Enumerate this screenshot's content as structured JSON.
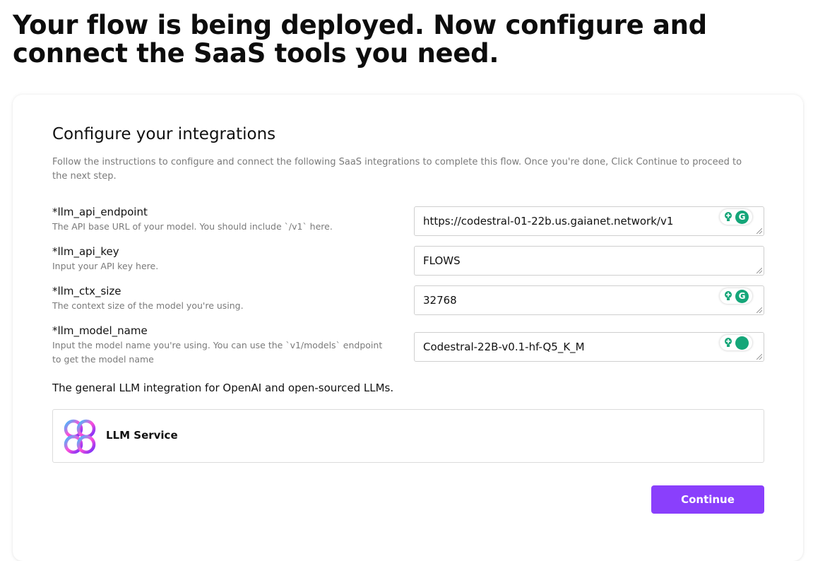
{
  "page": {
    "heading": "Your flow is being deployed. Now configure and connect the SaaS tools you need."
  },
  "card": {
    "title": "Configure your integrations",
    "description": "Follow the instructions to configure and connect the following SaaS integrations to complete this flow. Once you're done, Click Continue to proceed to the next step."
  },
  "fields": [
    {
      "label": "*llm_api_endpoint",
      "help": "The API base URL of your model. You should include `/v1` here.",
      "value": "https://codestral-01-22b.us.gaianet.network/v1",
      "extension_badge": "grammarly-icon"
    },
    {
      "label": "*llm_api_key",
      "help": "Input your API key here.",
      "value": "FLOWS"
    },
    {
      "label": "*llm_ctx_size",
      "help": "The context size of the model you're using.",
      "value": "32768",
      "extension_badge": "grammarly-icon"
    },
    {
      "label": "*llm_model_name",
      "help": "Input the model name you're using. You can use the `v1/models` endpoint to get the model name",
      "value": "Codestral-22B-v0.1-hf-Q5_K_M",
      "extension_badge": "grammarly-icon"
    }
  ],
  "integration": {
    "description": "The general LLM integration for OpenAI and open-sourced LLMs.",
    "service_name": "LLM Service",
    "logo_icon": "llm-service-logo-icon"
  },
  "actions": {
    "continue_label": "Continue"
  },
  "colors": {
    "accent": "#8a3ffc",
    "extension_green": "#15a679"
  }
}
